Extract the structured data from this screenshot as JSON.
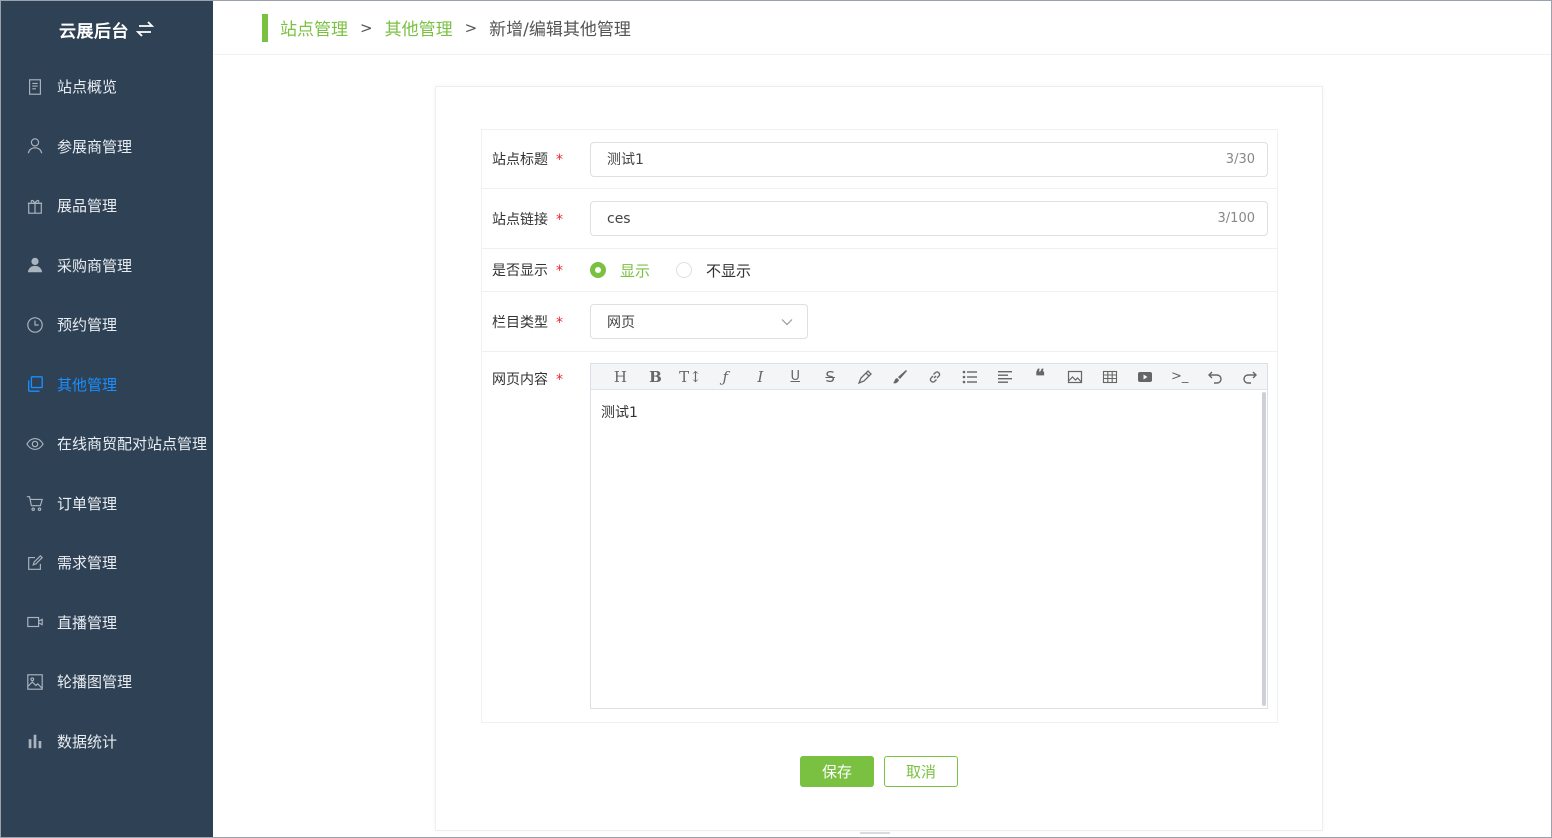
{
  "brand": {
    "title": "云展后台",
    "swap_icon": "swap-icon"
  },
  "sidebar": {
    "items": [
      {
        "label": "站点概览",
        "icon": "document-icon"
      },
      {
        "label": "参展商管理",
        "icon": "user-outline-icon"
      },
      {
        "label": "展品管理",
        "icon": "gift-icon"
      },
      {
        "label": "采购商管理",
        "icon": "user-filled-icon"
      },
      {
        "label": "预约管理",
        "icon": "clock-icon"
      },
      {
        "label": "其他管理",
        "icon": "copy-icon",
        "active": true
      },
      {
        "label": "在线商贸配对站点管理",
        "icon": "eye-icon"
      },
      {
        "label": "订单管理",
        "icon": "cart-icon"
      },
      {
        "label": "需求管理",
        "icon": "edit-icon"
      },
      {
        "label": "直播管理",
        "icon": "video-icon"
      },
      {
        "label": "轮播图管理",
        "icon": "image-icon"
      },
      {
        "label": "数据统计",
        "icon": "bar-chart-icon"
      }
    ]
  },
  "breadcrumb": {
    "level1": "站点管理",
    "level2": "其他管理",
    "current": "新增/编辑其他管理",
    "separator": ">"
  },
  "form": {
    "title_label": "站点标题",
    "title_value": "测试1",
    "title_count": "3/30",
    "link_label": "站点链接",
    "link_value": "ces",
    "link_count": "3/100",
    "display_label": "是否显示",
    "display_yes": "显示",
    "display_no": "不显示",
    "type_label": "栏目类型",
    "type_value": "网页",
    "content_label": "网页内容",
    "content_value": "测试1",
    "required_mark": "*"
  },
  "buttons": {
    "save": "保存",
    "cancel": "取消"
  },
  "colors": {
    "accent": "#7ac142",
    "sidebar_bg": "#2f4155",
    "active_menu": "#1890ff",
    "required": "#f5222d"
  }
}
